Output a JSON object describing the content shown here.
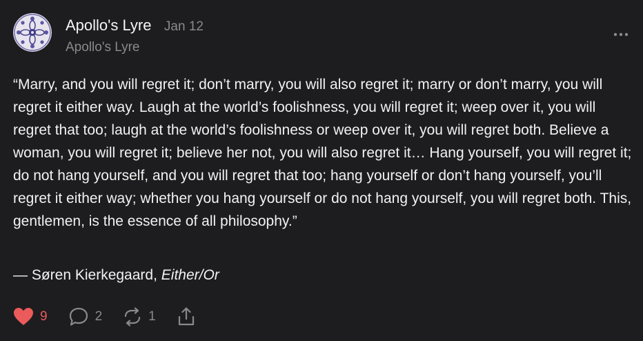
{
  "post": {
    "author": "Apollo's Lyre",
    "date": "Jan 12",
    "publication": "Apollo's Lyre",
    "avatar_icon": "lyre-medallion",
    "more_icon": "ellipsis-horizontal-icon",
    "quote": "“Marry, and you will regret it; don’t marry, you will also regret it; marry or don’t marry, you will regret it either way. Laugh at the world’s foolishness, you will regret it; weep over it, you will regret that too; laugh at the world’s foolishness or weep over it, you will regret both. Believe a woman, you will regret it; believe her not, you will also regret it… Hang yourself, you will regret it; do not hang yourself, and you will regret that too; hang yourself or don’t hang yourself, you’ll regret it either way; whether you hang yourself or do not hang yourself, you will regret both. This, gentlemen, is the essence of all philosophy.”",
    "attribution": {
      "prefix": "— Søren Kierkegaard, ",
      "work": "Either/Or"
    }
  },
  "actions": {
    "likes": "9",
    "comments": "2",
    "restacks": "1",
    "like_color": "#ec5b5b"
  }
}
